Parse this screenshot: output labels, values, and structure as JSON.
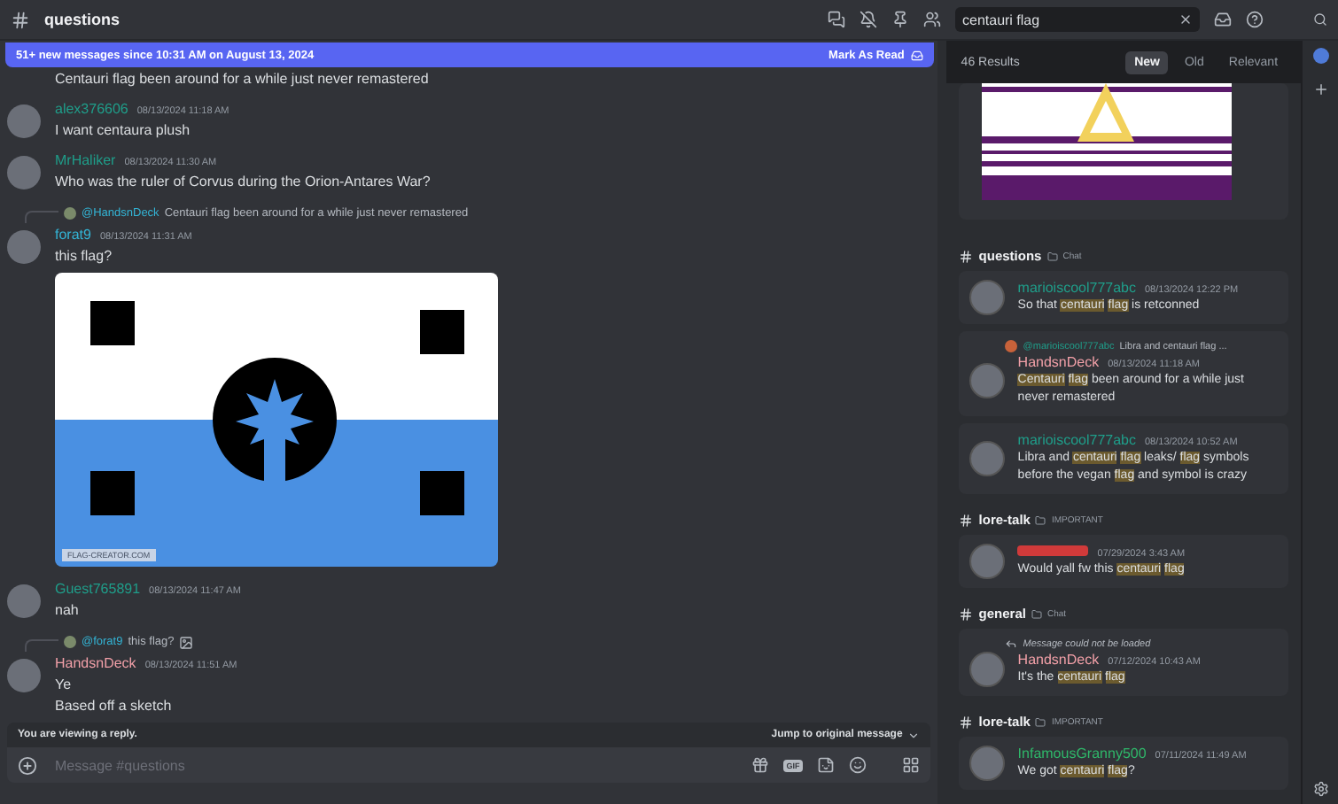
{
  "channel": {
    "name": "questions"
  },
  "toolbar": {
    "search": {
      "value": "centauri flag"
    }
  },
  "banner": {
    "text": "51+ new messages since 10:31 AM on August 13, 2024",
    "action": "Mark As Read"
  },
  "messages": [
    {
      "kind": "continued",
      "lines": [
        "Centauri flag been around for a while just never remastered"
      ]
    },
    {
      "kind": "message",
      "author": "alex376606",
      "color": "#1f9e8a",
      "time": "08/13/2024 11:18 AM",
      "lines": [
        "I want centaura plush"
      ]
    },
    {
      "kind": "message",
      "author": "MrHaliker",
      "color": "#1f9e8a",
      "time": "08/13/2024 11:30 AM",
      "lines": [
        "Who was the ruler of Corvus during the Orion-Antares War?"
      ]
    },
    {
      "kind": "message",
      "author": "forat9",
      "color": "#33b5d6",
      "time": "08/13/2024 11:31 AM",
      "reply": {
        "author": "@HandsnDeck",
        "text": "Centauri flag been around for a while just never remastered",
        "image": false
      },
      "lines": [
        "this flag?"
      ],
      "attachment": {
        "kind": "flag",
        "source": "FLAG-CREATOR.COM"
      }
    },
    {
      "kind": "message",
      "author": "Guest765891",
      "color": "#1f9e8a",
      "time": "08/13/2024 11:47 AM",
      "lines": [
        "nah"
      ]
    },
    {
      "kind": "message",
      "author": "HandsnDeck",
      "color": "#f2a0a8",
      "time": "08/13/2024 11:51 AM",
      "reply": {
        "author": "@forat9",
        "text": "this flag?",
        "image": true
      },
      "lines": [
        "Ye",
        "Based off a sketch"
      ]
    }
  ],
  "reply_bar": {
    "text": "You are viewing a reply.",
    "action": "Jump to original message"
  },
  "composer": {
    "placeholder": "Message #questions",
    "gif_label": "GIF"
  },
  "search_results": {
    "count": "46 Results",
    "sorts": [
      {
        "label": "New",
        "selected": true
      },
      {
        "label": "Old",
        "selected": false
      },
      {
        "label": "Relevant",
        "selected": false
      }
    ],
    "groups": [
      {
        "channel": "questions",
        "category": "Chat",
        "results": [
          {
            "author": "marioiscool777abc",
            "color": "#1f9e8a",
            "time": "08/13/2024 12:22 PM",
            "segments": [
              {
                "text": "So that ",
                "highlight": false
              },
              {
                "text": "centauri",
                "highlight": true
              },
              {
                "text": "flag",
                "highlight": true
              },
              {
                "text": " is retconned",
                "highlight": false
              }
            ]
          },
          {
            "author": "HandsnDeck",
            "color": "#f2a0a8",
            "time": "08/13/2024 11:18 AM",
            "reply": {
              "kind": "quote",
              "author": "@marioiscool777abc",
              "text": "Libra and centauri flag ..."
            },
            "segments": [
              {
                "text": "Centauri",
                "highlight": true
              },
              {
                "text": "flag",
                "highlight": true
              },
              {
                "text": " been around for a while just never remastered",
                "highlight": false
              }
            ]
          },
          {
            "author": "marioiscool777abc",
            "color": "#1f9e8a",
            "time": "08/13/2024 10:52 AM",
            "segments": [
              {
                "text": "Libra and ",
                "highlight": false
              },
              {
                "text": "centauri",
                "highlight": true
              },
              {
                "text": "flag",
                "highlight": true
              },
              {
                "text": " leaks/ ",
                "highlight": false
              },
              {
                "text": "flag",
                "highlight": true
              },
              {
                "text": " symbols before the vegan ",
                "highlight": false
              },
              {
                "text": "flag",
                "highlight": true
              },
              {
                "text": " and symbol is crazy",
                "highlight": false
              }
            ]
          }
        ]
      },
      {
        "channel": "lore-talk",
        "category": "IMPORTANT",
        "results": [
          {
            "color": "#d03a3a",
            "time": "07/29/2024 3:43 AM",
            "segments": [
              {
                "text": "Would yall fw this ",
                "highlight": false
              },
              {
                "text": "centauri",
                "highlight": true
              },
              {
                "text": "flag",
                "highlight": true
              }
            ]
          }
        ]
      },
      {
        "channel": "general",
        "category": "Chat",
        "results": [
          {
            "author": "HandsnDeck",
            "color": "#f2a0a8",
            "time": "07/12/2024 10:43 AM",
            "reply": {
              "kind": "unavailable",
              "text": "Message could not be loaded"
            },
            "segments": [
              {
                "text": "It's the ",
                "highlight": false
              },
              {
                "text": "centauri",
                "highlight": true
              },
              {
                "text": "flag",
                "highlight": true
              }
            ]
          }
        ]
      },
      {
        "channel": "lore-talk",
        "category": "IMPORTANT",
        "results": [
          {
            "author": "InfamousGranny500",
            "color": "#2fb86a",
            "time": "07/11/2024 11:49 AM",
            "segments": [
              {
                "text": "We got ",
                "highlight": false
              },
              {
                "text": "centauri",
                "highlight": true
              },
              {
                "text": "flag",
                "highlight": true
              },
              {
                "text": "?",
                "highlight": false
              }
            ]
          }
        ]
      }
    ]
  }
}
